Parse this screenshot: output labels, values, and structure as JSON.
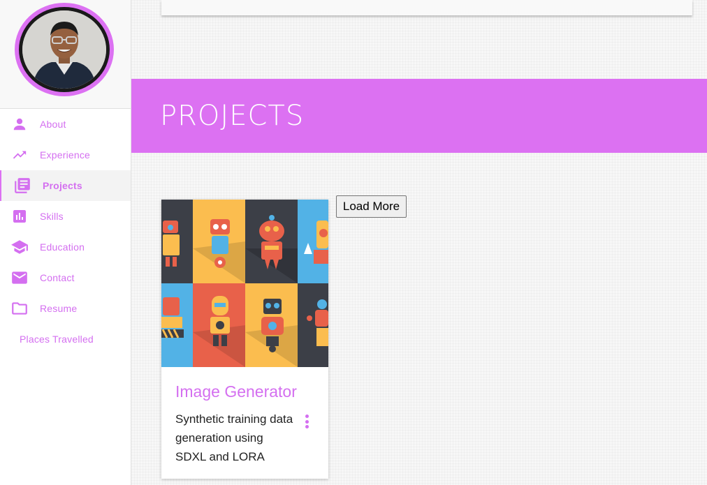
{
  "sidebar": {
    "items": [
      {
        "label": "About",
        "icon": "person-icon"
      },
      {
        "label": "Experience",
        "icon": "trending-up-icon"
      },
      {
        "label": "Projects",
        "icon": "library-books-icon",
        "active": true
      },
      {
        "label": "Skills",
        "icon": "bar-chart-icon"
      },
      {
        "label": "Education",
        "icon": "school-icon"
      },
      {
        "label": "Contact",
        "icon": "mail-icon"
      },
      {
        "label": "Resume",
        "icon": "folder-icon"
      },
      {
        "label": "Places Travelled"
      }
    ]
  },
  "banner": {
    "title": "PROJECTS"
  },
  "projects": [
    {
      "title": "Image Generator",
      "description": "Synthetic training data generation using SDXL and LORA",
      "menu_icon": "more-vert-icon"
    }
  ],
  "load_more_label": "Load More",
  "colors": {
    "accent": "#dc71f2",
    "text_dark": "#222222"
  }
}
